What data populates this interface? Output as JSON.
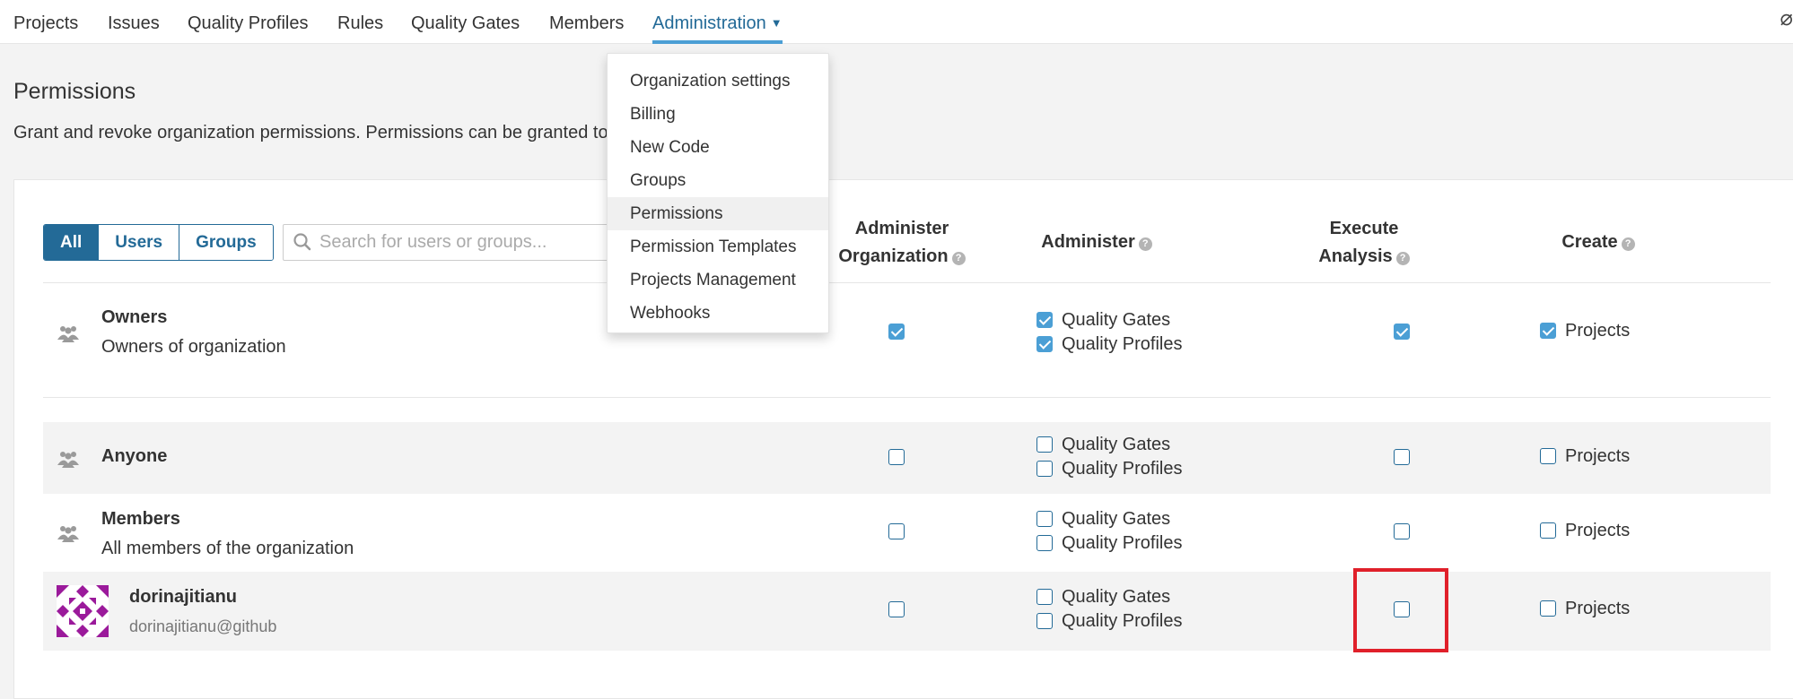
{
  "nav": {
    "items": [
      "Projects",
      "Issues",
      "Quality Profiles",
      "Rules",
      "Quality Gates",
      "Members"
    ],
    "admin_label": "Administration",
    "corner_glyph": "⌀"
  },
  "page": {
    "title": "Permissions",
    "description": "Grant and revoke organization permissions. Permissions can be granted to"
  },
  "filters": {
    "all": "All",
    "users": "Users",
    "groups": "Groups",
    "selected": "All"
  },
  "search": {
    "placeholder": "Search for users or groups..."
  },
  "columns": {
    "admin_org_line1": "Administer",
    "admin_org_line2": "Organization",
    "administer": "Administer",
    "execute_line1": "Execute",
    "execute_line2": "Analysis",
    "create": "Create"
  },
  "labels": {
    "quality_gates": "Quality Gates",
    "quality_profiles": "Quality Profiles",
    "projects": "Projects"
  },
  "rows": [
    {
      "name": "Owners",
      "description": "Owners of organization",
      "admin_org": true,
      "quality_gates": true,
      "quality_profiles": true,
      "execute": true,
      "projects": true
    },
    {
      "name": "Anyone",
      "description": "",
      "admin_org": false,
      "quality_gates": false,
      "quality_profiles": false,
      "execute": false,
      "projects": false
    },
    {
      "name": "Members",
      "description": "All members of the organization",
      "admin_org": false,
      "quality_gates": false,
      "quality_profiles": false,
      "execute": false,
      "projects": false
    },
    {
      "name": "dorinajitianu",
      "login": "dorinajitianu@github",
      "admin_org": false,
      "quality_gates": false,
      "quality_profiles": false,
      "execute": false,
      "projects": false
    }
  ],
  "dropdown": {
    "items": [
      "Organization settings",
      "Billing",
      "New Code",
      "Groups",
      "Permissions",
      "Permission Templates",
      "Projects Management",
      "Webhooks"
    ],
    "active": "Permissions"
  },
  "colors": {
    "accent": "#236a97",
    "checkbox_on": "#4b9fd5",
    "highlight": "#e0202a",
    "avatar": "#9b1a9b"
  }
}
